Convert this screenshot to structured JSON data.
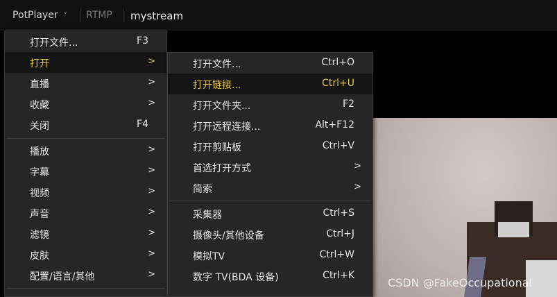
{
  "titlebar": {
    "app_name": "PotPlayer",
    "chevron": "˅",
    "protocol": "RTMP",
    "stream": "mystream"
  },
  "main_menu": [
    {
      "label": "打开文件...",
      "shortcut": "F3",
      "arrow": ""
    },
    {
      "label": "打开",
      "shortcut": "",
      "arrow": ">"
    },
    {
      "label": "直播",
      "shortcut": "",
      "arrow": ">"
    },
    {
      "label": "收藏",
      "shortcut": "",
      "arrow": ">"
    },
    {
      "label": "关闭",
      "shortcut": "F4",
      "arrow": ""
    },
    {
      "label": "播放",
      "shortcut": "",
      "arrow": ">"
    },
    {
      "label": "字幕",
      "shortcut": "",
      "arrow": ">"
    },
    {
      "label": "视频",
      "shortcut": "",
      "arrow": ">"
    },
    {
      "label": "声音",
      "shortcut": "",
      "arrow": ">"
    },
    {
      "label": "滤镜",
      "shortcut": "",
      "arrow": ">"
    },
    {
      "label": "皮肤",
      "shortcut": "",
      "arrow": ">"
    },
    {
      "label": "配置/语言/其他",
      "shortcut": "",
      "arrow": ">"
    }
  ],
  "open_submenu": [
    {
      "label": "打开文件...",
      "shortcut": "Ctrl+O",
      "arrow": ""
    },
    {
      "label": "打开链接...",
      "shortcut": "Ctrl+U",
      "arrow": ""
    },
    {
      "label": "打开文件夹...",
      "shortcut": "F2",
      "arrow": ""
    },
    {
      "label": "打开远程连接...",
      "shortcut": "Alt+F12",
      "arrow": ""
    },
    {
      "label": "打开剪贴板",
      "shortcut": "Ctrl+V",
      "arrow": ""
    },
    {
      "label": "首选打开方式",
      "shortcut": "",
      "arrow": ">"
    },
    {
      "label": "简索",
      "shortcut": "",
      "arrow": ">"
    },
    {
      "label": "采集器",
      "shortcut": "Ctrl+S",
      "arrow": ""
    },
    {
      "label": "摄像头/其他设备",
      "shortcut": "Ctrl+J",
      "arrow": ""
    },
    {
      "label": "模拟TV",
      "shortcut": "Ctrl+W",
      "arrow": ""
    },
    {
      "label": "数字 TV(BDA 设备)",
      "shortcut": "Ctrl+K",
      "arrow": ""
    }
  ],
  "watermark": "CSDN @FakeOccupational",
  "colors": {
    "highlight": "#e8c63a",
    "menu_bg": "#262626",
    "active_bg": "#141414"
  }
}
